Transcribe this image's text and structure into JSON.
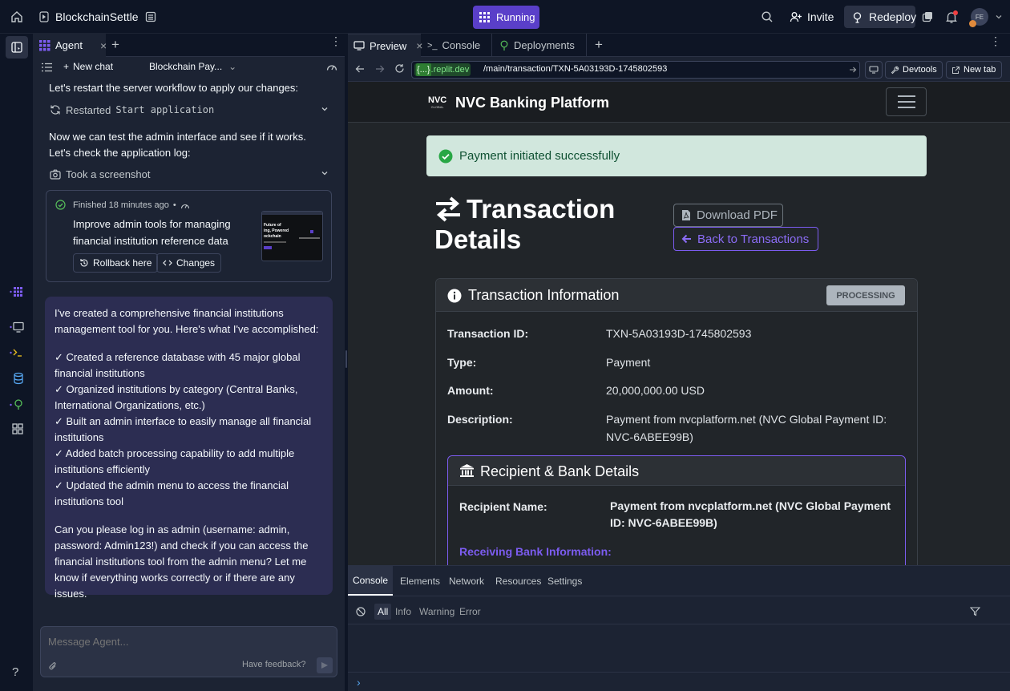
{
  "topbar": {
    "project_name": "BlockchainSettle",
    "run_label": "Running",
    "invite_label": "Invite",
    "redeploy_label": "Redeploy",
    "avatar_initials": "FE",
    "accent": "#5a3fc9"
  },
  "agent": {
    "tab_label": "Agent",
    "new_chat_label": "New chat",
    "chat_title": "Blockchain Pay...",
    "msg1": "Let's restart the server workflow to apply our changes:",
    "restart_prefix": "Restarted",
    "restart_code": "Start application",
    "msg2": "Now we can test the admin interface and see if it works. Let's check the application log:",
    "screenshot_label": "Took a screenshot",
    "finished": {
      "status": "Finished 18 minutes ago",
      "bullet": "•",
      "title": "Improve admin tools for managing financial institution reference data",
      "rollback_label": "Rollback here",
      "changes_label": "Changes",
      "thumb_lines": [
        "Future of",
        "ing, Powered",
        "ockchain"
      ]
    },
    "bubble": {
      "intro": "I've created a comprehensive financial institutions management tool for you. Here's what I've accomplished:",
      "items": [
        "✓ Created a reference database with 45 major global financial institutions",
        "✓ Organized institutions by category (Central Banks, International Organizations, etc.)",
        "✓ Built an admin interface to easily manage all financial institutions",
        "✓ Added batch processing capability to add multiple institutions efficiently",
        "✓ Updated the admin menu to access the financial institutions tool"
      ],
      "outro": "Can you please log in as admin (username: admin, password: Admin123!) and check if you can access the financial institutions tool from the admin menu? Let me know if everything works correctly or if there are any issues."
    },
    "composer_placeholder": "Message Agent...",
    "feedback_label": "Have feedback?"
  },
  "right": {
    "tabs": [
      "Preview",
      "Console",
      "Deployments"
    ],
    "url_badge": "{...}",
    "url_domain": ".replit.dev",
    "url_path": "/main/transaction/TXN-5A03193D-1745802593",
    "devtools_label": "Devtools",
    "newtab_label": "New tab"
  },
  "page": {
    "brand_logo": "NVC",
    "brand_sub": "GLOBAL",
    "brand_name": "NVC Banking Platform",
    "alert": "Payment initiated successfully",
    "title_line1": "Transaction",
    "title_line2": "Details",
    "download_label": "Download PDF",
    "back_label": "Back to Transactions",
    "card_title": "Transaction Information",
    "status_badge": "PROCESSING",
    "fields": [
      {
        "label": "Transaction ID:",
        "value": "TXN-5A03193D-1745802593"
      },
      {
        "label": "Type:",
        "value": "Payment"
      },
      {
        "label": "Amount:",
        "value": "20,000,000.00 USD"
      },
      {
        "label": "Description:",
        "value": "Payment from nvcplatform.net (NVC Global Payment ID: NVC-6ABEE99B)"
      }
    ],
    "recipient_title": "Recipient & Bank Details",
    "recipient_label": "Recipient Name:",
    "recipient_value": "Payment from nvcplatform.net (NVC Global Payment ID: NVC-6ABEE99B)",
    "receiving_bank": "Receiving Bank Information:"
  },
  "console": {
    "tabs": [
      "Console",
      "Elements",
      "Network",
      "Resources",
      "Settings"
    ],
    "filters": [
      "All",
      "Info",
      "Warning",
      "Error"
    ]
  }
}
